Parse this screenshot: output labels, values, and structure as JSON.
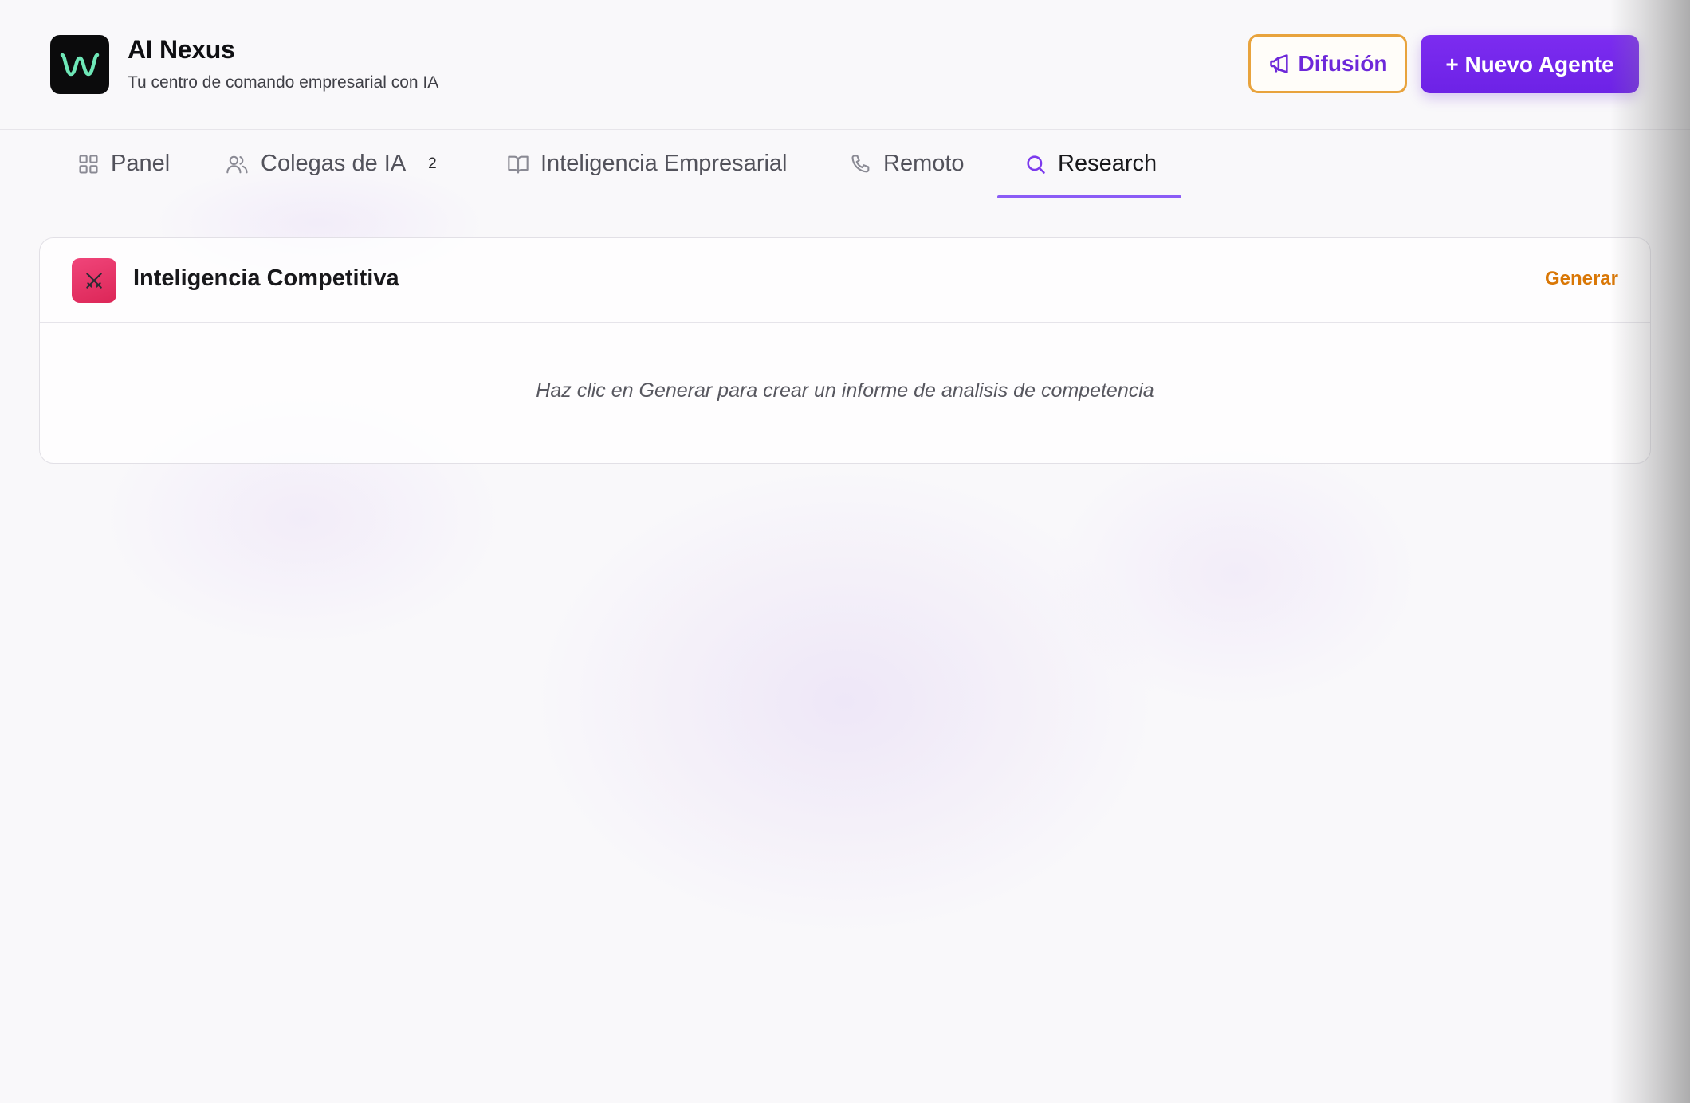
{
  "app": {
    "title": "AI Nexus",
    "subtitle": "Tu centro de comando empresarial con IA",
    "logo_icon": "wave-w-logo-icon"
  },
  "header": {
    "broadcast_label": "Difusión",
    "broadcast_icon": "megaphone-icon",
    "new_agent_label": "+ Nuevo Agente"
  },
  "tabs": [
    {
      "label": "Panel",
      "icon": "grid-icon",
      "active": false
    },
    {
      "label": "Colegas de IA",
      "icon": "users-icon",
      "badge": "2",
      "active": false
    },
    {
      "label": "Inteligencia Empresarial",
      "icon": "book-icon",
      "active": false
    },
    {
      "label": "Remoto",
      "icon": "phone-icon",
      "active": false
    },
    {
      "label": "Research",
      "icon": "search-icon",
      "active": true
    }
  ],
  "card": {
    "title": "Inteligencia Competitiva",
    "icon": "crossed-swords-icon",
    "action_label": "Generar",
    "empty_text": "Haz clic en Generar para crear un informe de analisis de competencia"
  },
  "colors": {
    "accent": "#7c2cf0",
    "tab_indicator": "#8b5cf6",
    "broadcast_border": "#e8a33d",
    "generate_text": "#d97706",
    "card_icon_bg": "#e11d48",
    "logo_bg": "#0b0b0c",
    "logo_stroke": "#6ee7b7"
  }
}
